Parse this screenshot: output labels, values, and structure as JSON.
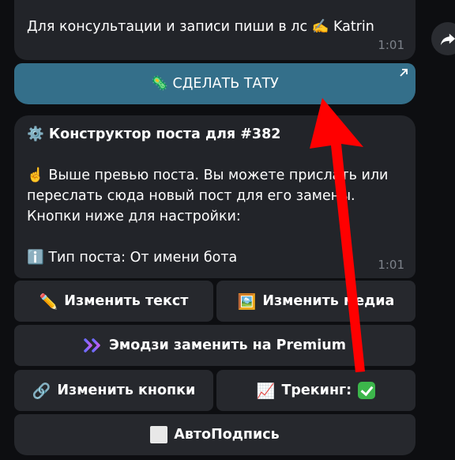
{
  "messages": {
    "top": {
      "text": "Для консультации и записи пиши в лс ✍️ Katrin",
      "time": "1:01"
    },
    "main": {
      "title": "⚙️ Конструктор поста для #382",
      "line1": "☝️ Выше превью поста. Вы можете прислать или",
      "line2": "переслать сюда новый пост для его замены.",
      "line3": "Кнопки ниже для настройки:",
      "line4": "ℹ️ Тип поста: От имени бота",
      "time": "1:01"
    }
  },
  "url_button": {
    "label": "🦠 СДЕЛАТЬ ТАТУ"
  },
  "keyboard": {
    "edit_text": "Изменить текст",
    "edit_media": "Изменить медиа",
    "emoji_premium": "Эмодзи заменить на Premium",
    "edit_buttons": "Изменить кнопки",
    "tracking": "Трекинг:",
    "autosign": "АвтоПодпись"
  },
  "colors": {
    "url_button": "#346f8a",
    "bubble": "#222429",
    "keyboard_button": "#26282d",
    "arrow": "#ff0000",
    "check": "#3cb64b"
  },
  "icons": {
    "edit_text": "pencil-icon",
    "edit_media": "framed-picture-icon",
    "emoji_premium": "premium-chevrons-icon",
    "edit_buttons": "link-icon",
    "tracking": "chart-increasing-icon",
    "tracking_state": "check-mark-icon",
    "autosign": "white-square-icon",
    "forward": "share-icon",
    "external_link": "arrow-up-right-icon"
  }
}
